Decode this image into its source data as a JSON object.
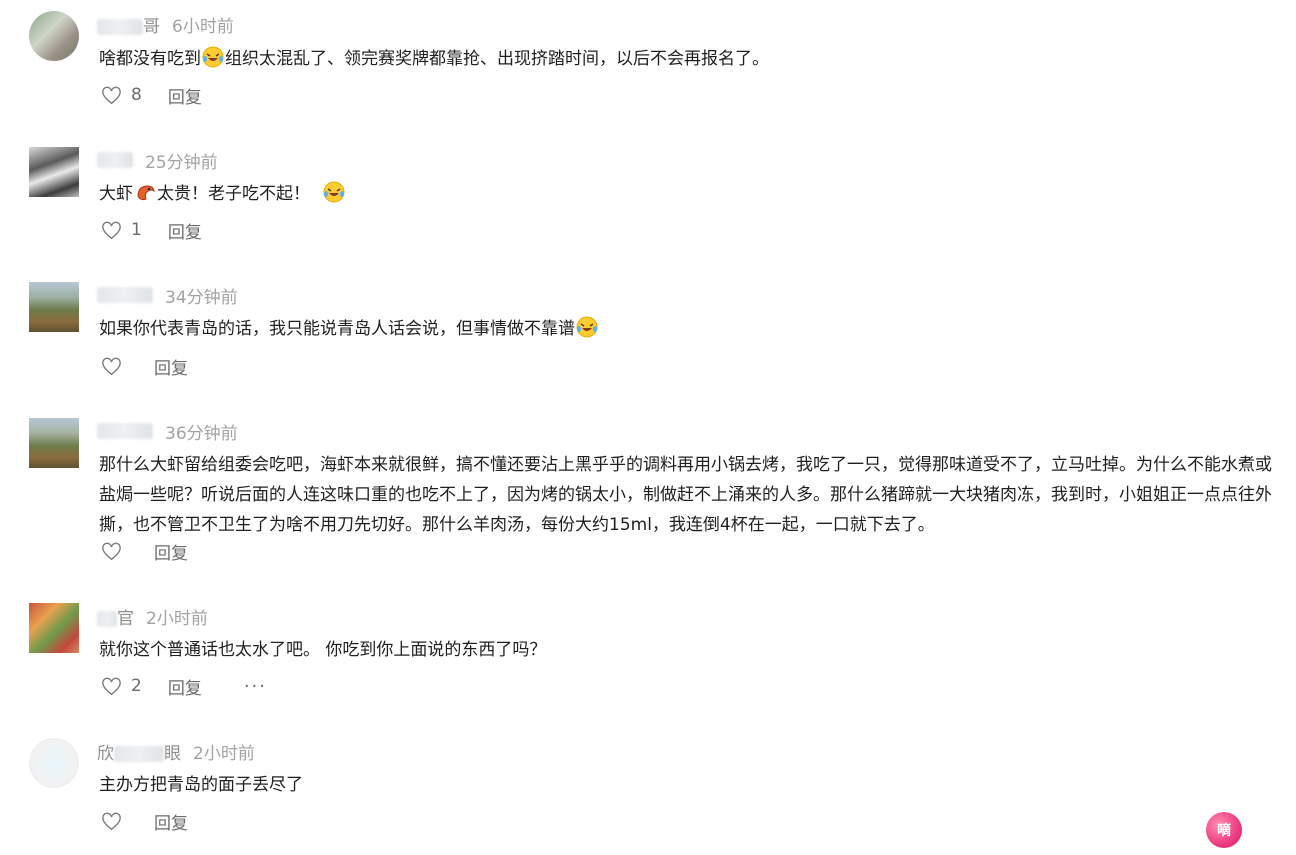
{
  "comments": [
    {
      "name_visible": "哥",
      "time": "6小时前",
      "text_a": "啥都没有吃到",
      "emoji_a": "laughing-crying-emoji",
      "text_b": "组织太混乱了、领完赛奖牌都靠抢、出现挤踏时间，以后不会再报名了。",
      "likes": "8",
      "reply": "回复"
    },
    {
      "name_visible": "",
      "time": "25分钟前",
      "text_a": "大虾",
      "emoji_a": "shrimp-emoji",
      "text_b": "太贵！老子吃不起！",
      "emoji_b": "laughing-crying-emoji",
      "likes": "1",
      "reply": "回复"
    },
    {
      "name_visible": "",
      "time": "34分钟前",
      "text_a": "如果你代表青岛的话，我只能说青岛人话会说，但事情做不靠谱",
      "emoji_a": "laughing-crying-emoji",
      "likes": "",
      "reply": "回复"
    },
    {
      "name_visible": "",
      "time": "36分钟前",
      "text_a": "那什么大虾留给组委会吃吧，海虾本来就很鲜，搞不懂还要沾上黑乎乎的调料再用小锅去烤，我吃了一只，觉得那味道受不了，立马吐掉。为什么不能水煮或盐焗一些呢？听说后面的人连这味口重的也吃不上了，因为烤的锅太小，制做赶不上涌来的人多。那什么猪蹄就一大块猪肉冻，我到时，小姐姐正一点点往外撕，也不管卫不卫生了为啥不用刀先切好。那什么羊肉汤，每份大约15ml，我连倒4杯在一起，一口就下去了。",
      "likes": "",
      "reply": "回复"
    },
    {
      "name_visible": "官",
      "time": "2小时前",
      "text_a": "就你这个普通话也太水了吧。 你吃到你上面说的东西了吗？",
      "likes": "2",
      "reply": "回复",
      "more": "···"
    },
    {
      "name_visible_a": "欣",
      "name_visible_b": "眼",
      "time": "2小时前",
      "text_a": "主办方把青岛的面子丢尽了",
      "likes": "",
      "reply": "回复"
    }
  ],
  "watermark": "嘀",
  "colors": {
    "text": "#1f1f1f",
    "meta": "#a3a3a3",
    "action": "#6b6b6b"
  }
}
